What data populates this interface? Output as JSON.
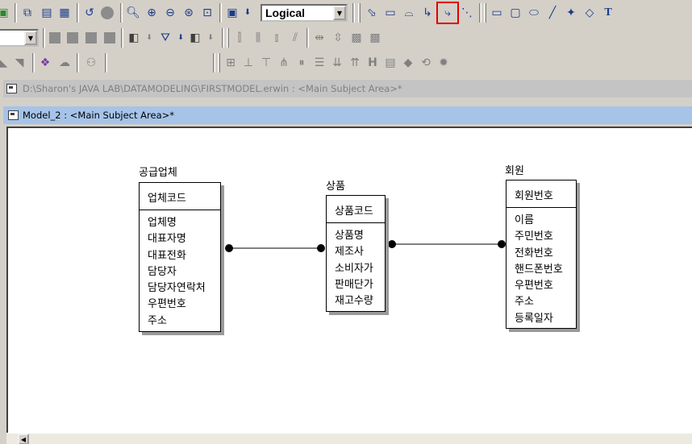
{
  "toolbar": {
    "view_mode": "Logical",
    "icons_row1": [
      "model-icon",
      "new-subject-icon",
      "subject-area-icon",
      "stored-display-icon",
      "undo-icon",
      "circle-icon",
      "zoom-icon",
      "zoom-in-icon",
      "zoom-out-icon",
      "zoom-fit-icon",
      "zoom-full-icon",
      "layout-icon",
      "dropdown-arrow-icon",
      "select-icon",
      "entity-icon",
      "view-icon",
      "identifying-rel-icon",
      "non-identifying-rel-icon",
      "many-to-many-rel-icon",
      "rectangle-icon",
      "rounded-rect-icon",
      "ellipse-icon",
      "line-icon",
      "link-icon",
      "tag-icon",
      "text-icon"
    ],
    "highlighted_tool": "non-identifying-rel-icon"
  },
  "windows": {
    "background_title": "D:\\Sharon's JAVA LAB\\DATAMODELING\\FIRSTMODEL.erwin : <Main Subject Area>*",
    "active_title": "Model_2 : <Main Subject Area>*"
  },
  "entities": [
    {
      "name": "공급업체",
      "key": "업체코드",
      "attributes": [
        "업체명",
        "대표자명",
        "대표전화",
        "담당자",
        "담당자연락처",
        "우편번호",
        "주소"
      ]
    },
    {
      "name": "상품",
      "key": "상품코드",
      "attributes": [
        "상품명",
        "제조사",
        "소비자가",
        "판매단가",
        "재고수량"
      ]
    },
    {
      "name": "회원",
      "key": "회원번호",
      "attributes": [
        "이름",
        "주민번호",
        "전화번호",
        "핸드폰번호",
        "우편번호",
        "주소",
        "등록일자"
      ]
    }
  ],
  "colors": {
    "highlight": "#e00000",
    "title_bar": "#a6c3e8"
  }
}
